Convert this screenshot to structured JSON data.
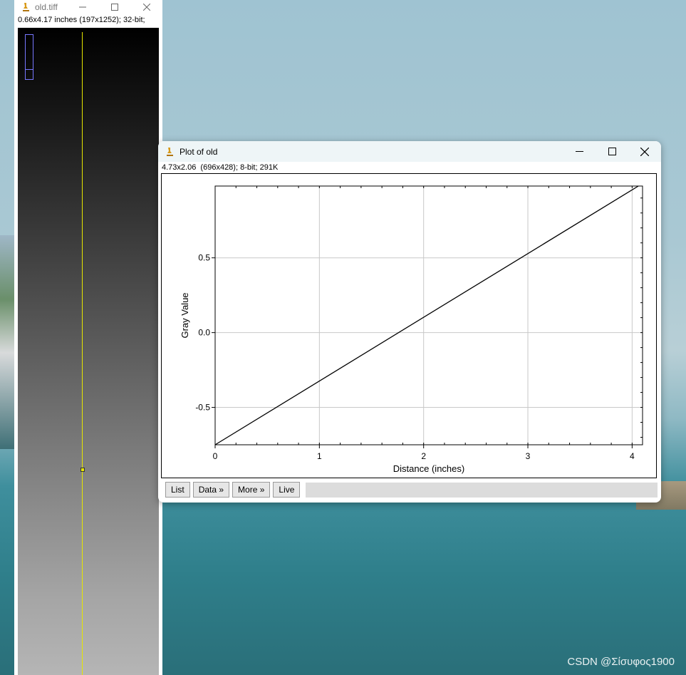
{
  "old_window": {
    "title": "old.tiff",
    "info": "0.66x4.17 inches (197x1252); 32-bit;",
    "icon": "microscope-icon"
  },
  "plot_window": {
    "title": "Plot of old",
    "info": "4.73x2.06  (696x428); 8-bit; 291K",
    "icon": "microscope-icon",
    "buttons": {
      "list": "List",
      "data": "Data »",
      "more": "More »",
      "live": "Live"
    }
  },
  "chart_data": {
    "type": "line",
    "xlabel": "Distance (inches)",
    "ylabel": "Gray Value",
    "xlim": [
      0,
      4.1
    ],
    "ylim": [
      -0.75,
      0.98
    ],
    "xticks": [
      0,
      1,
      2,
      3,
      4
    ],
    "xtick_labels": [
      "0",
      "1",
      "2",
      "3",
      "4"
    ],
    "yticks": [
      -0.5,
      0.0,
      0.5
    ],
    "ytick_labels": [
      "-0.5",
      "0.0",
      "0.5"
    ],
    "grid": true,
    "series": [
      {
        "x": [
          0,
          4.06
        ],
        "y": [
          -0.75,
          0.99
        ]
      }
    ],
    "line_color": "#000000",
    "grid_color": "#c8c8c8"
  },
  "watermark": "CSDN @Σίσυφος1900"
}
